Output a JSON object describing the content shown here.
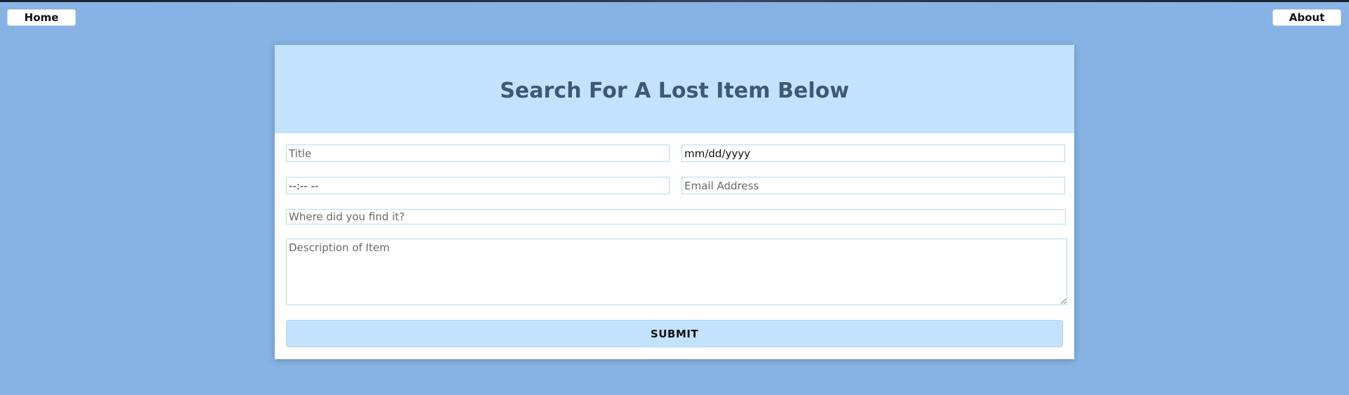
{
  "nav": {
    "home_label": "Home",
    "about_label": "About"
  },
  "form": {
    "title": "Search For A Lost Item Below",
    "fields": {
      "title_placeholder": "Title",
      "date_value": "mm/dd/yyyy",
      "time_value": "--:-- --",
      "email_placeholder": "Email Address",
      "location_placeholder": "Where did you find it?",
      "description_placeholder": "Description of Item"
    },
    "submit_label": "SUBMIT"
  },
  "colors": {
    "page_background": "#86b3e3",
    "header_background": "#c3e2fd",
    "title_color": "#3d5973",
    "submit_background": "#c3e2fd"
  }
}
